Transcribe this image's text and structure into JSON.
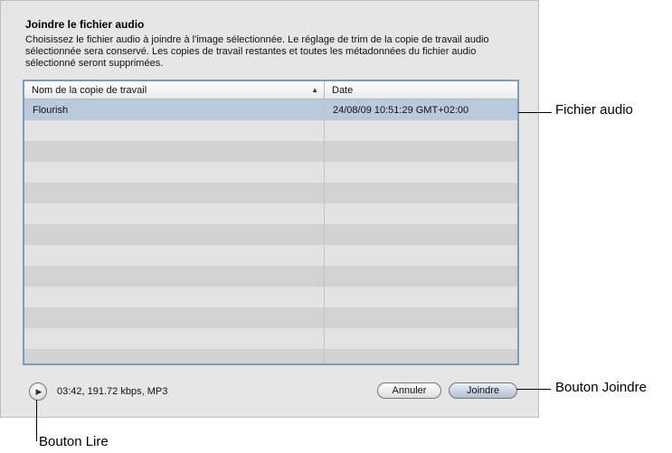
{
  "dialog": {
    "title": "Joindre le fichier audio",
    "description": "Choisissez le fichier audio à joindre à l'image sélectionnée. Le réglage de trim de la copie de travail audio sélectionnée sera conservé. Les copies de travail restantes et toutes les métadonnées du fichier audio sélectionné seront supprimées."
  },
  "table": {
    "columns": [
      "Nom de la copie de travail",
      "Date"
    ],
    "sort_indicator": "▲",
    "rows": [
      {
        "name": "Flourish",
        "date": "24/08/09 10:51:29 GMT+02:00"
      }
    ]
  },
  "footer": {
    "play_icon": "▶",
    "info": "03:42, 191.72 kbps, MP3",
    "cancel_label": "Annuler",
    "join_label": "Joindre"
  },
  "callouts": {
    "audio_file": "Fichier audio",
    "join_button": "Bouton Joindre",
    "play_button": "Bouton Lire"
  },
  "colors": {
    "dialog_bg": "#e6e6e6",
    "table_border": "#7d9bc0",
    "selected_row": "#bac9db"
  }
}
